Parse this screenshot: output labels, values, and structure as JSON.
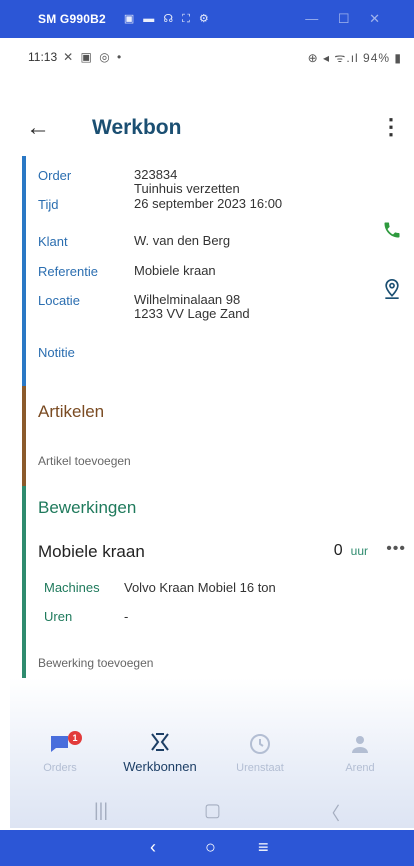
{
  "mirror": {
    "device": "SM G990B2",
    "icons": "▣ ▬ ☊ ⛶ ⚙",
    "window_controls": "— ☐ ✕"
  },
  "status_bar": {
    "time": "11:13",
    "left_icons": "✕ ▣ ◎ •",
    "right_icons": "⊕ ◂ ᯤ.ıl 94% ▮"
  },
  "header": {
    "title": "Werkbon"
  },
  "order": {
    "label": "Order",
    "value": "323834",
    "value2": "Tuinhuis verzetten",
    "time_label": "Tijd",
    "time_value": "26 september 2023 16:00",
    "client_label": "Klant",
    "client_value": "W. van den Berg",
    "ref_label": "Referentie",
    "ref_value": "Mobiele kraan",
    "loc_label": "Locatie",
    "loc_line1": "Wilhelminalaan 98",
    "loc_line2": "1233 VV Lage Zand",
    "note_label": "Notitie"
  },
  "articles": {
    "title": "Artikelen",
    "add_label": "Artikel toevoegen"
  },
  "operations": {
    "title": "Bewerkingen",
    "item_name": "Mobiele kraan",
    "hours": "0",
    "hours_unit": "uur",
    "more": "•••",
    "machines_label": "Machines",
    "machines_value": "Volvo Kraan Mobiel 16 ton",
    "hours_label": "Uren",
    "hours_value": "-",
    "add_label": "Bewerking toevoegen"
  },
  "bottom_nav": {
    "items": [
      {
        "label": "Orders",
        "badge": "1"
      },
      {
        "label": "Werkbonnen"
      },
      {
        "label": "Urenstaat"
      },
      {
        "label": "Arend"
      }
    ]
  },
  "colors": {
    "accent_blue": "#2a78c5",
    "articles_brown": "#8b5a2b",
    "operations_green": "#2e8b6e",
    "title_navy": "#1b4f72",
    "phone_green": "#2e9a3e",
    "window_blue": "#2c56d6"
  }
}
